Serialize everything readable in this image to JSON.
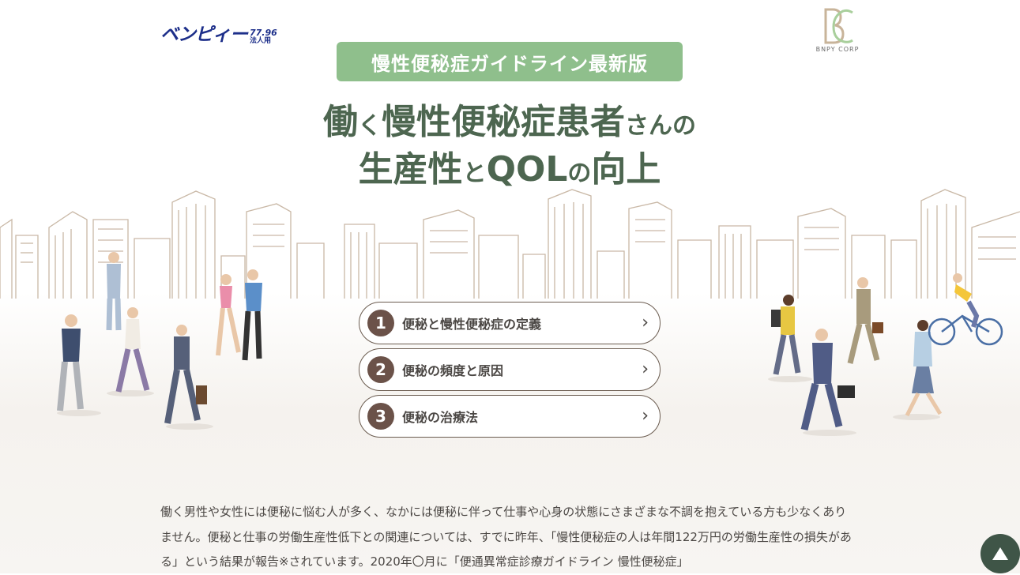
{
  "header": {
    "logo_brand": "ベンピィー",
    "logo_number": "77.96",
    "logo_corp": "法人用",
    "corp_logo_text": "BNPY CORP"
  },
  "hero": {
    "tag": "慢性便秘症ガイドライン最新版",
    "line1_a": "働",
    "line1_b": "く",
    "line1_c": "慢性便秘症患者",
    "line1_d": "さんの",
    "line2_a": "生産性",
    "line2_b": "と",
    "line2_c": "QOL",
    "line2_d": "の",
    "line2_e": "向上"
  },
  "menu": [
    {
      "num": "1",
      "label": "便秘と慢性便秘症の定義"
    },
    {
      "num": "2",
      "label": "便秘の頻度と原因"
    },
    {
      "num": "3",
      "label": "便秘の治療法"
    }
  ],
  "intro": {
    "text": "働く男性や女性には便秘に悩む人が多く、なかには便秘に伴って仕事や心身の状態にさまざまな不調を抱えている方も少なくありません。便秘と仕事の労働生産性低下との関連については、すでに昨年、「慢性便秘症の人は年間122万円の労働生産性の損失がある」という結果が報告※されています。2020年〇月に「便通異常症診療ガイドライン 慢性便秘症」"
  },
  "colors": {
    "accent_green": "#8fbf8c",
    "headline_green": "#4d6650",
    "badge_brown": "#6b5249",
    "brand_blue": "#1d2f8a",
    "totop_bg": "#3f5547"
  },
  "icons": {
    "chevron": "›",
    "totop": "up-triangle-icon"
  }
}
